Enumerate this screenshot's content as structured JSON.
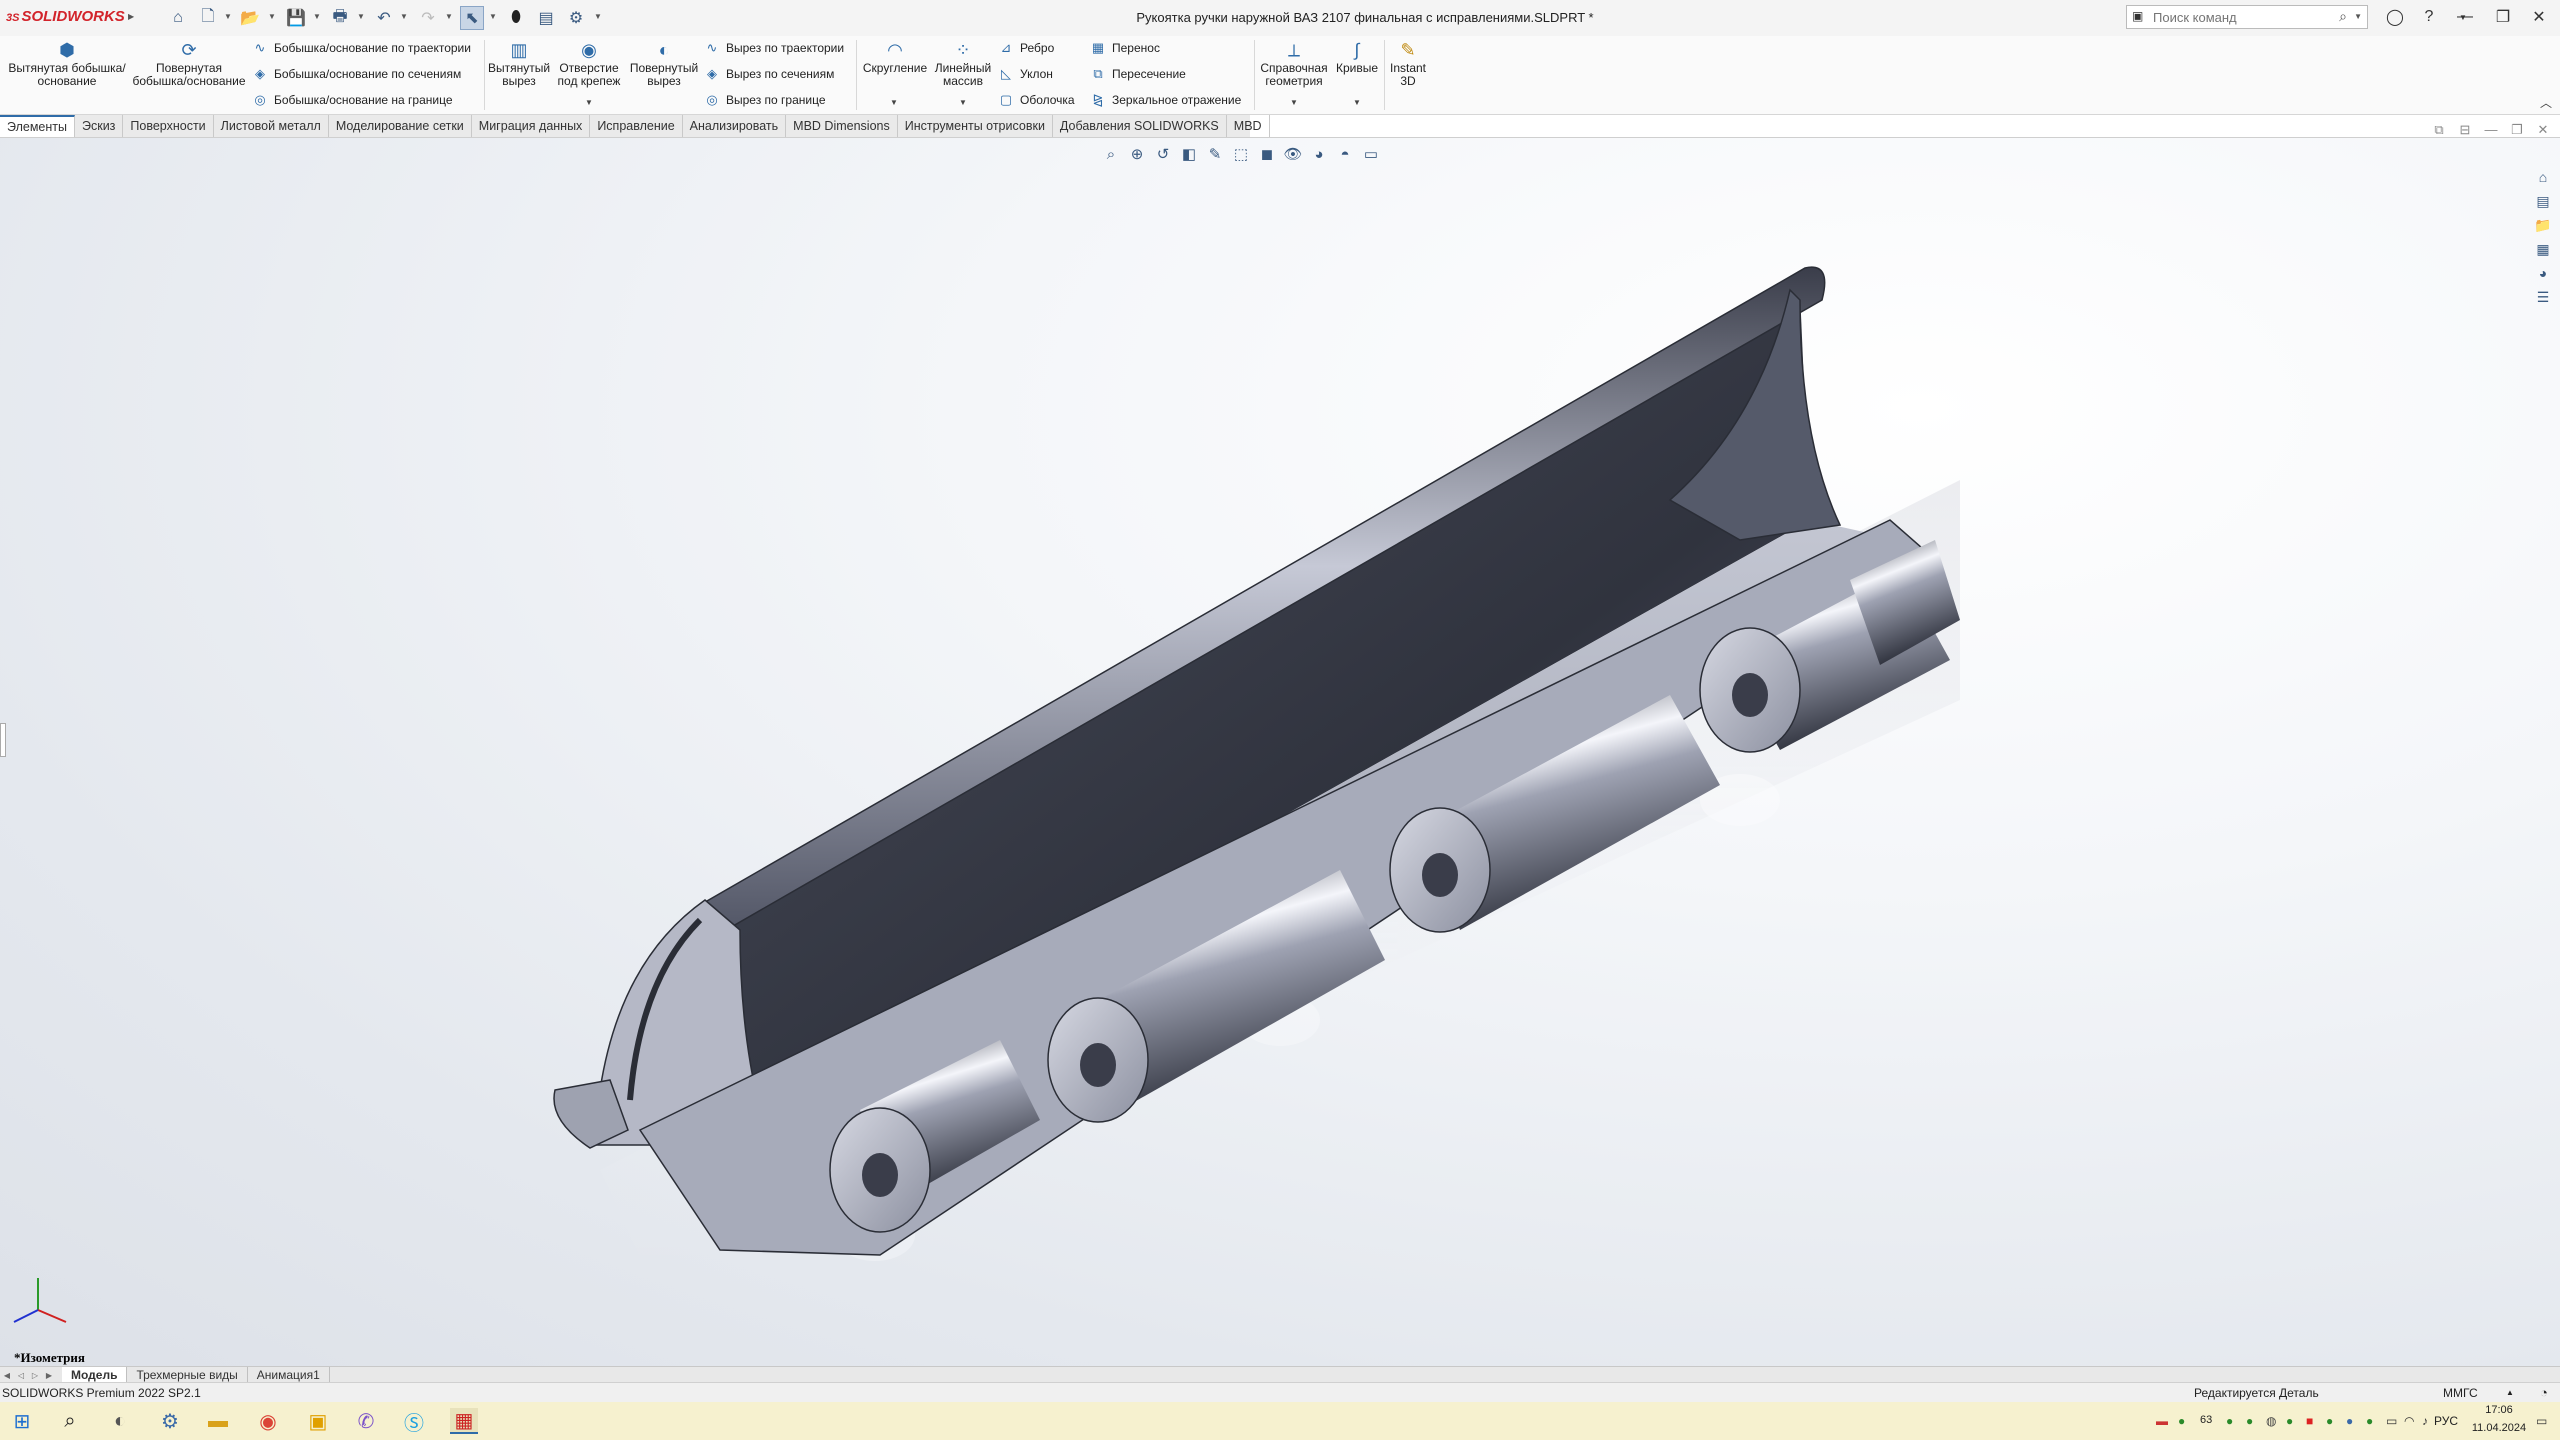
{
  "app": {
    "logo_prefix": "3S",
    "logo": "SOLIDWORKS",
    "title": "Рукоятка ручки наружной ВАЗ 2107 финальная с исправлениями.SLDPRT *"
  },
  "search": {
    "placeholder": "Поиск команд"
  },
  "ribbon": {
    "extruded_boss": "Вытянутая бобышка/основание",
    "revolved_boss": "Повернутая бобышка/основание",
    "swept_boss": "Бобышка/основание по траектории",
    "lofted_boss": "Бобышка/основание по сечениям",
    "boundary_boss": "Бобышка/основание на границе",
    "extruded_cut": "Вытянутый вырез",
    "hole_wizard": "Отверстие под крепеж",
    "revolved_cut": "Повернутый вырез",
    "swept_cut": "Вырез по траектории",
    "lofted_cut": "Вырез по сечениям",
    "boundary_cut": "Вырез по границе",
    "fillet": "Скругление",
    "linear_pattern": "Линейный массив",
    "rib": "Ребро",
    "draft": "Уклон",
    "shell": "Оболочка",
    "wrap": "Перенос",
    "intersect": "Пересечение",
    "mirror": "Зеркальное отражение",
    "ref_geometry": "Справочная геометрия",
    "curves": "Кривые",
    "instant3d": "Instant 3D"
  },
  "tabs": [
    "Элементы",
    "Эскиз",
    "Поверхности",
    "Листовой металл",
    "Моделирование сетки",
    "Миграция данных",
    "Исправление",
    "Анализировать",
    "MBD Dimensions",
    "Инструменты отрисовки",
    "Добавления SOLIDWORKS",
    "MBD"
  ],
  "view_label": "*Изометрия",
  "bottom_tabs": [
    "Модель",
    "Трехмерные виды",
    "Анимация1"
  ],
  "status": {
    "version": "SOLIDWORKS Premium 2022 SP2.1",
    "mode": "Редактируется Деталь",
    "units": "ММГС"
  },
  "taskbar": {
    "lang": "РУС",
    "time": "17:06",
    "date": "11.04.2024",
    "badge": "63"
  },
  "colors": {
    "accent": "#2f6ca8",
    "brand": "#d2232a",
    "taskbar": "#f6f1cf"
  }
}
